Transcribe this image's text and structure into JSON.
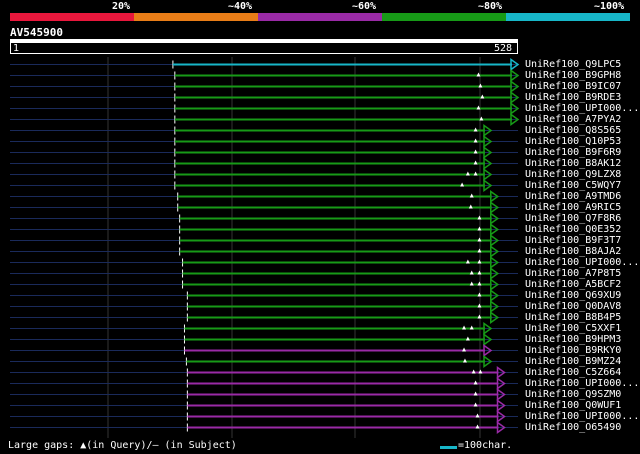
{
  "legend": {
    "labels": [
      "20%",
      "~40%",
      "~60%",
      "~80%",
      "~100%"
    ],
    "colors": [
      "#e8173c",
      "#e87d17",
      "#9a2aa6",
      "#179a17",
      "#17b6c8"
    ]
  },
  "query": {
    "name": "AV545900",
    "start": "1",
    "end": "528",
    "length": 528
  },
  "colors": {
    "background": "#000000",
    "guide": "#1a2a5a",
    "gridline": "#333333",
    "identity_100": "#17b6c8",
    "identity_80": "#179a17",
    "identity_60": "#9a2aa6"
  },
  "hits": [
    {
      "name": "UniRef100_Q9LPC5",
      "start": 170,
      "end": 528,
      "identity": "100",
      "gaps": []
    },
    {
      "name": "UniRef100_B9GPH8",
      "start": 172,
      "end": 528,
      "identity": "80",
      "gaps": [
        487
      ]
    },
    {
      "name": "UniRef100_B9IC07",
      "start": 172,
      "end": 528,
      "identity": "80",
      "gaps": [
        489
      ]
    },
    {
      "name": "UniRef100_B9RDE3",
      "start": 172,
      "end": 528,
      "identity": "80",
      "gaps": [
        491
      ]
    },
    {
      "name": "UniRef100_UPI000...",
      "start": 172,
      "end": 528,
      "identity": "80",
      "gaps": [
        487
      ]
    },
    {
      "name": "UniRef100_A7PYA2",
      "start": 172,
      "end": 528,
      "identity": "80",
      "gaps": [
        490
      ]
    },
    {
      "name": "UniRef100_Q8S565",
      "start": 172,
      "end": 500,
      "identity": "80",
      "gaps": [
        484
      ]
    },
    {
      "name": "UniRef100_Q10P53",
      "start": 172,
      "end": 500,
      "identity": "80",
      "gaps": [
        484
      ]
    },
    {
      "name": "UniRef100_B9F6R9",
      "start": 172,
      "end": 500,
      "identity": "80",
      "gaps": [
        484
      ]
    },
    {
      "name": "UniRef100_B8AK12",
      "start": 172,
      "end": 500,
      "identity": "80",
      "gaps": [
        484
      ]
    },
    {
      "name": "UniRef100_Q9LZX8",
      "start": 172,
      "end": 500,
      "identity": "80",
      "gaps": [
        476,
        484
      ]
    },
    {
      "name": "UniRef100_C5WQY7",
      "start": 172,
      "end": 500,
      "identity": "80",
      "gaps": [
        470
      ]
    },
    {
      "name": "UniRef100_A9TMD6",
      "start": 175,
      "end": 507,
      "identity": "80",
      "gaps": [
        480
      ]
    },
    {
      "name": "UniRef100_A9RIC5",
      "start": 175,
      "end": 507,
      "identity": "80",
      "gaps": [
        479
      ]
    },
    {
      "name": "UniRef100_Q7F8R6",
      "start": 177,
      "end": 507,
      "identity": "80",
      "gaps": [
        488
      ]
    },
    {
      "name": "UniRef100_Q0E352",
      "start": 177,
      "end": 507,
      "identity": "80",
      "gaps": [
        488
      ]
    },
    {
      "name": "UniRef100_B9F3T7",
      "start": 177,
      "end": 507,
      "identity": "80",
      "gaps": [
        488
      ]
    },
    {
      "name": "UniRef100_B8AJA2",
      "start": 177,
      "end": 507,
      "identity": "80",
      "gaps": [
        488
      ]
    },
    {
      "name": "UniRef100_UPI000...",
      "start": 180,
      "end": 507,
      "identity": "80",
      "gaps": [
        476,
        488
      ]
    },
    {
      "name": "UniRef100_A7P8T5",
      "start": 180,
      "end": 507,
      "identity": "80",
      "gaps": [
        480,
        488
      ]
    },
    {
      "name": "UniRef100_A5BCF2",
      "start": 180,
      "end": 507,
      "identity": "80",
      "gaps": [
        480,
        488
      ]
    },
    {
      "name": "UniRef100_Q69XU9",
      "start": 185,
      "end": 507,
      "identity": "80",
      "gaps": [
        488
      ]
    },
    {
      "name": "UniRef100_Q0DAV8",
      "start": 185,
      "end": 507,
      "identity": "80",
      "gaps": [
        488
      ]
    },
    {
      "name": "UniRef100_B8B4P5",
      "start": 185,
      "end": 507,
      "identity": "80",
      "gaps": [
        488
      ]
    },
    {
      "name": "UniRef100_C5XXF1",
      "start": 182,
      "end": 500,
      "identity": "80",
      "gaps": [
        472,
        480
      ]
    },
    {
      "name": "UniRef100_B9HPM3",
      "start": 182,
      "end": 500,
      "identity": "80",
      "gaps": [
        476
      ]
    },
    {
      "name": "UniRef100_B9RKY0",
      "start": 182,
      "end": 500,
      "identity": "60",
      "gaps": [
        472
      ]
    },
    {
      "name": "UniRef100_B9MZ24",
      "start": 184,
      "end": 500,
      "identity": "80",
      "gaps": [
        473
      ]
    },
    {
      "name": "UniRef100_C5Z664",
      "start": 185,
      "end": 514,
      "identity": "60",
      "gaps": [
        482,
        489
      ]
    },
    {
      "name": "UniRef100_UPI000...",
      "start": 185,
      "end": 514,
      "identity": "60",
      "gaps": [
        484
      ]
    },
    {
      "name": "UniRef100_Q9SZM0",
      "start": 185,
      "end": 514,
      "identity": "60",
      "gaps": [
        484
      ]
    },
    {
      "name": "UniRef100_Q0WUF1",
      "start": 185,
      "end": 514,
      "identity": "60",
      "gaps": [
        484
      ]
    },
    {
      "name": "UniRef100_UPI000...",
      "start": 185,
      "end": 514,
      "identity": "60",
      "gaps": [
        486
      ]
    },
    {
      "name": "UniRef100_O65490",
      "start": 185,
      "end": 514,
      "identity": "60",
      "gaps": [
        486
      ]
    }
  ],
  "footer": {
    "gaps_text": "Large gaps: ▲(in Query)/– (in Subject)",
    "scale_text": "=100char."
  }
}
